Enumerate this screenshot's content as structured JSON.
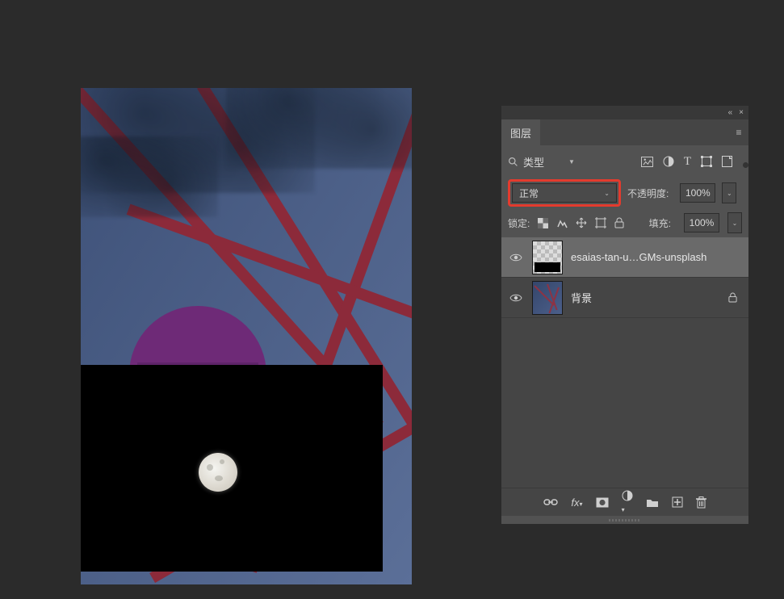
{
  "panel": {
    "tab_label": "图层",
    "filter": {
      "search_placeholder": "",
      "kind_label": "类型"
    },
    "blend": {
      "mode": "正常",
      "opacity_label": "不透明度:",
      "opacity_value": "100%"
    },
    "lock": {
      "label": "锁定:",
      "fill_label": "填充:",
      "fill_value": "100%"
    },
    "layers": [
      {
        "visible": true,
        "selected": true,
        "name": "esaias-tan-u…GMs-unsplash",
        "locked": false,
        "thumb_kind": "moon"
      },
      {
        "visible": true,
        "selected": false,
        "name": "背景",
        "locked": true,
        "thumb_kind": "bg"
      }
    ],
    "top_icons": {
      "collapse": "«",
      "close": "×",
      "menu": "≡"
    }
  }
}
